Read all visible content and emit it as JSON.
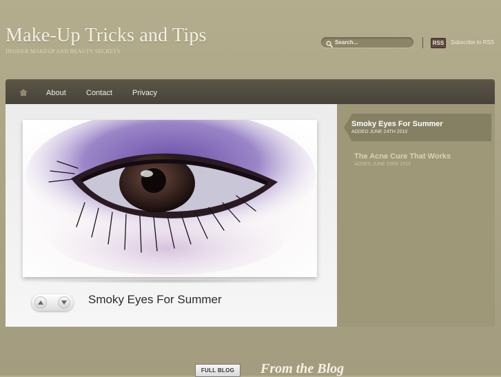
{
  "site": {
    "title": "Make-Up Tricks and Tips",
    "tagline": "INSIDER MAKEUP AND BEAUTY SECRETS"
  },
  "search": {
    "placeholder": "Search...",
    "icon": "search-icon"
  },
  "rss": {
    "badge": "RSS",
    "link_label": "Subscribe to RSS"
  },
  "nav": {
    "home_icon": "home-icon",
    "items": [
      {
        "label": "About"
      },
      {
        "label": "Contact"
      },
      {
        "label": "Privacy"
      }
    ]
  },
  "feature": {
    "title": "Smoky Eyes For Summer",
    "image": "eye-with-smoky-purple-makeup",
    "prev_icon": "chevron-up-icon",
    "next_icon": "chevron-down-icon"
  },
  "sidebar": {
    "posts": [
      {
        "title": "Smoky Eyes For Summer",
        "date": "ADDED JUNE 24TH 2010",
        "active": true
      },
      {
        "title": "The Acne Cure That Works",
        "date": "ADDED JUNE 23RD 2010",
        "active": false
      }
    ]
  },
  "footer": {
    "full_blog_label": "FULL BLOG",
    "section_heading": "From the Blog"
  },
  "colors": {
    "background": "#aba486",
    "nav_bar": "#4f4b40",
    "sidebar": "#9e9778",
    "active_post": "#857f63",
    "active_post_title": "#ffffff",
    "inactive_post_title": "#d9d2b4"
  }
}
